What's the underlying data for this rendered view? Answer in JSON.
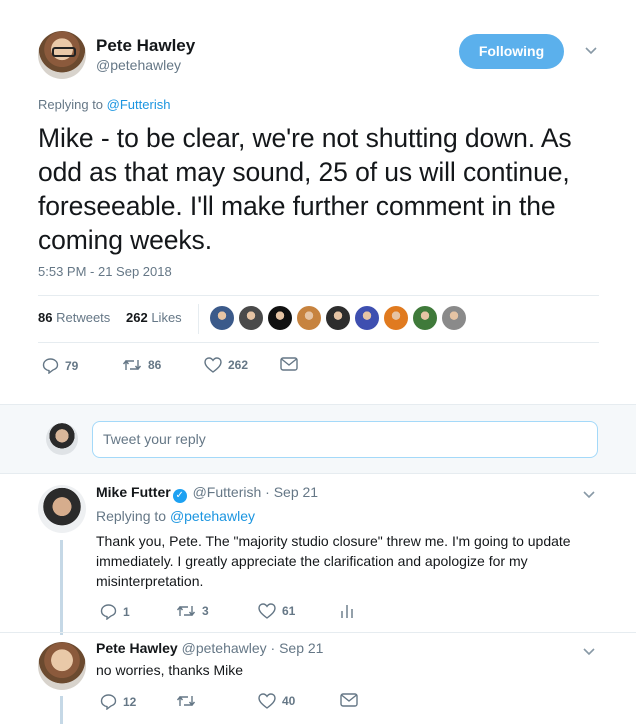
{
  "tweet": {
    "author_name": "Pete Hawley",
    "author_handle": "@petehawley",
    "follow_label": "Following",
    "replying_prefix": "Replying to",
    "replying_to": "@Futterish",
    "text": "Mike - to be clear, we're not shutting down. As odd as that may sound, 25 of us will continue, foreseeable. I'll make further comment in the coming weeks.",
    "timestamp": "5:53 PM - 21 Sep 2018",
    "retweets_count": "86",
    "retweets_label": "Retweets",
    "likes_count": "262",
    "likes_label": "Likes",
    "likers": [
      {
        "color": "#3b5a8a"
      },
      {
        "color": "#4a4a4a"
      },
      {
        "color": "#111111"
      },
      {
        "color": "#c7833f"
      },
      {
        "color": "#2d2d2d"
      },
      {
        "color": "#3e4fb0"
      },
      {
        "color": "#e07a1f"
      },
      {
        "color": "#3f7a3a"
      },
      {
        "color": "#8a8a8a"
      }
    ],
    "actions": {
      "replies": "79",
      "retweets": "86",
      "likes": "262"
    }
  },
  "reply_box": {
    "placeholder": "Tweet your reply"
  },
  "replies": [
    {
      "name": "Mike Futter",
      "handle": "@Futterish",
      "date": "· Sep 21",
      "replying_prefix": "Replying to",
      "replying_to": "@petehawley",
      "text": "Thank you, Pete. The \"majority studio closure\" threw me. I'm going to update immediately. I greatly appreciate the clarification and apologize for my misinterpretation.",
      "actions": {
        "replies": "1",
        "retweets": "3",
        "likes": "61"
      }
    },
    {
      "name": "Pete Hawley",
      "handle": "@petehawley",
      "date": "· Sep 21",
      "text": "no worries, thanks Mike",
      "actions": {
        "replies": "12",
        "retweets": "",
        "likes": "40"
      }
    }
  ],
  "colors": {
    "accent": "#1b95e0",
    "follow_button": "#5bb0ec",
    "muted": "#657786"
  }
}
